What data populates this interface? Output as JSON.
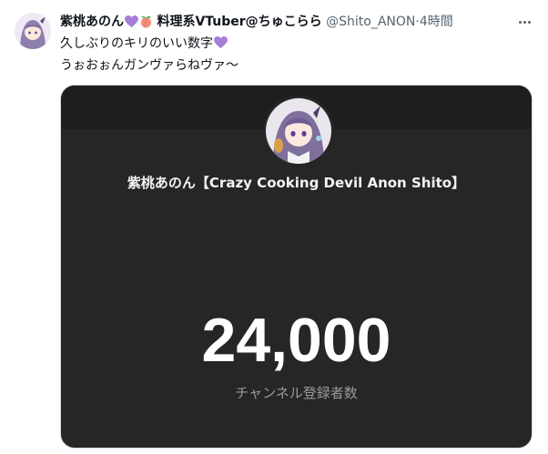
{
  "tweet": {
    "display_name": "紫桃あのん",
    "display_name_suffix": "料理系VTuber@ちゅこらら",
    "emojis": [
      "purple-heart",
      "peach"
    ],
    "handle": "@Shito_ANON",
    "separator": "·",
    "time": "4時間",
    "text_lines": [
      "久しぶりのキリのいい数字",
      "うぉおぉんガンヴァらねヴァ～"
    ],
    "text_emoji": "purple-heart",
    "more_icon": "more-horizontal-icon"
  },
  "card": {
    "channel_name": "紫桃あのん【Crazy Cooking Devil Anon Shito】",
    "subscriber_count": "24,000",
    "subscriber_label": "チャンネル登録者数"
  },
  "colors": {
    "card_background": "#262626",
    "card_header": "#1e1e1e",
    "secondary_text": "#536471",
    "accent_purple": "#a77fd8"
  }
}
